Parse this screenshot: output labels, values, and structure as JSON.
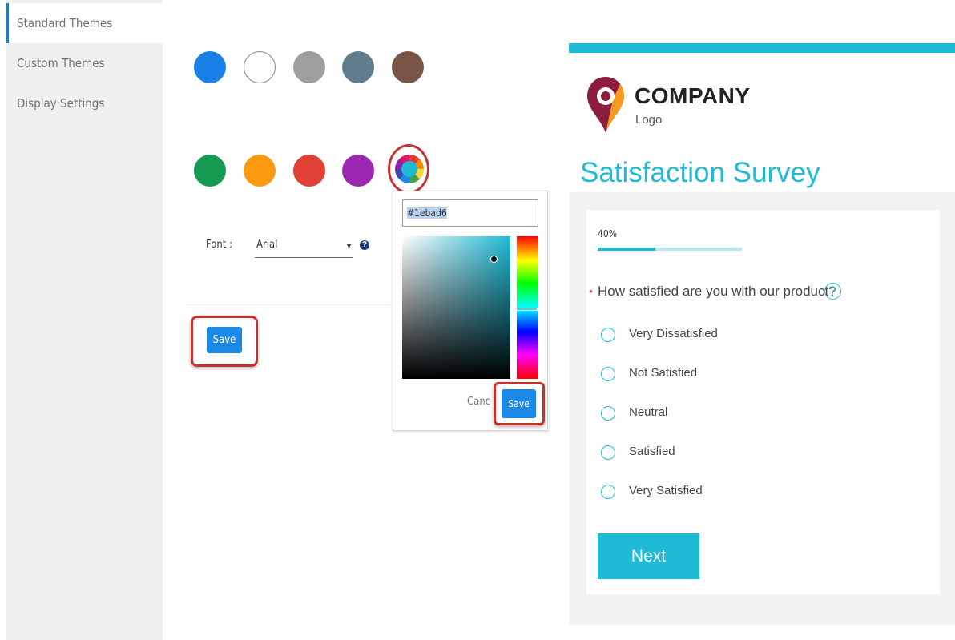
{
  "sidebar": {
    "items": [
      {
        "label": "Standard Themes",
        "active": true
      },
      {
        "label": "Custom Themes",
        "active": false
      },
      {
        "label": "Display Settings",
        "active": false
      }
    ]
  },
  "themes": {
    "swatch_colors": [
      "#1a7fe6",
      "#ffffff",
      "#9e9e9e",
      "#607d8b",
      "#795548",
      "#159a52",
      "#fd9a11",
      "#e14134",
      "#9c27b0"
    ],
    "custom_color_icon": "color-wheel-icon"
  },
  "font": {
    "label": "Font :",
    "value": "Arial",
    "help_icon": "question-icon",
    "help_symbol": "?"
  },
  "save_label": "Save",
  "color_picker": {
    "hex_value": "#1ebad6",
    "cancel_label": "Cancel",
    "save_label": "Save"
  },
  "preview": {
    "accent_color": "#1ebad6",
    "logo_title": "COMPANY",
    "logo_subtitle": "Logo",
    "survey_title": "Satisfaction Survey",
    "progress_text": "40%",
    "progress_value": 0.4,
    "required_mark": "•",
    "question": "How satisfied are you with our product?",
    "question_help": "?",
    "options": [
      "Very Dissatisfied",
      "Not Satisfied",
      "Neutral",
      "Satisfied",
      "Very Satisfied"
    ],
    "next_label": "Next"
  }
}
